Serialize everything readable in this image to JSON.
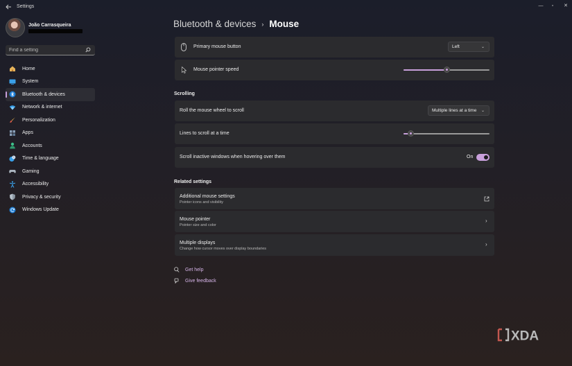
{
  "window": {
    "title": "Settings",
    "controls": {
      "minimize": "—",
      "maximize": "▫",
      "close": "✕"
    }
  },
  "user": {
    "name": "João Carrasqueira"
  },
  "search": {
    "placeholder": "Find a setting",
    "icon": "search-icon"
  },
  "nav": {
    "items": [
      {
        "label": "Home",
        "icon": "home-icon",
        "active": false
      },
      {
        "label": "System",
        "icon": "system-icon",
        "active": false
      },
      {
        "label": "Bluetooth & devices",
        "icon": "bluetooth-icon",
        "active": true
      },
      {
        "label": "Network & internet",
        "icon": "wifi-icon",
        "active": false
      },
      {
        "label": "Personalization",
        "icon": "brush-icon",
        "active": false
      },
      {
        "label": "Apps",
        "icon": "apps-icon",
        "active": false
      },
      {
        "label": "Accounts",
        "icon": "accounts-icon",
        "active": false
      },
      {
        "label": "Time & language",
        "icon": "clock-globe-icon",
        "active": false
      },
      {
        "label": "Gaming",
        "icon": "gamepad-icon",
        "active": false
      },
      {
        "label": "Accessibility",
        "icon": "accessibility-icon",
        "active": false
      },
      {
        "label": "Privacy & security",
        "icon": "shield-icon",
        "active": false
      },
      {
        "label": "Windows Update",
        "icon": "update-icon",
        "active": false
      }
    ]
  },
  "header": {
    "parent": "Bluetooth & devices",
    "separator": "›",
    "current": "Mouse"
  },
  "mouse": {
    "primary_button": {
      "label": "Primary mouse button",
      "value": "Left",
      "chevron": "⌄"
    },
    "pointer_speed": {
      "label": "Mouse pointer speed",
      "level": 0.5
    }
  },
  "scrolling": {
    "title": "Scrolling",
    "roll_wheel": {
      "label": "Roll the mouse wheel to scroll",
      "value": "Multiple lines at a time",
      "chevron": "⌄"
    },
    "lines_to_scroll": {
      "label": "Lines to scroll at a time",
      "level": 0.05
    },
    "inactive_scroll": {
      "label": "Scroll inactive windows when hovering over them",
      "state": "On"
    }
  },
  "related": {
    "title": "Related settings",
    "items": [
      {
        "title": "Additional mouse settings",
        "subtitle": "Pointer icons and visibility",
        "icon": "external-link-icon"
      },
      {
        "title": "Mouse pointer",
        "subtitle": "Pointer size and color",
        "icon": "chevron-right-icon"
      },
      {
        "title": "Multiple displays",
        "subtitle": "Change how cursor moves over display boundaries",
        "icon": "chevron-right-icon"
      }
    ],
    "chevron": "›"
  },
  "help": {
    "get_help": "Get help",
    "give_feedback": "Give feedback"
  },
  "watermark": {
    "text": "XDA"
  },
  "colors": {
    "accent": "#c9a0dc",
    "card": "#2b2b2e",
    "link": "#d6b4e8"
  }
}
